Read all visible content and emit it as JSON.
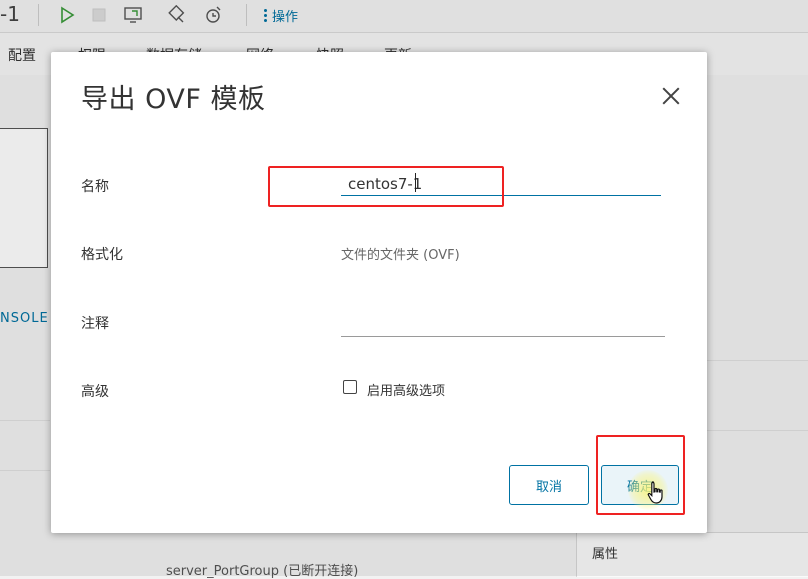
{
  "background": {
    "vm_suffix": "-1",
    "actions_label": "操作",
    "tabs": [
      "配置",
      "权限",
      "数据存储",
      "网络",
      "快照",
      "更新"
    ],
    "console_label": "NSOLE",
    "bottom_text": "server_PortGroup (已断开连接)",
    "properties_label": "属性"
  },
  "dialog": {
    "title": "导出 OVF 模板",
    "fields": {
      "name_label": "名称",
      "name_value": "centos7-1",
      "format_label": "格式化",
      "format_value": "文件的文件夹 (OVF)",
      "comment_label": "注释",
      "comment_value": "",
      "advanced_label": "高级",
      "advanced_checkbox_label": "启用高级选项"
    },
    "buttons": {
      "cancel": "取消",
      "ok": "确定"
    }
  },
  "colors": {
    "accent": "#0072a3",
    "highlight": "#ee2222"
  }
}
